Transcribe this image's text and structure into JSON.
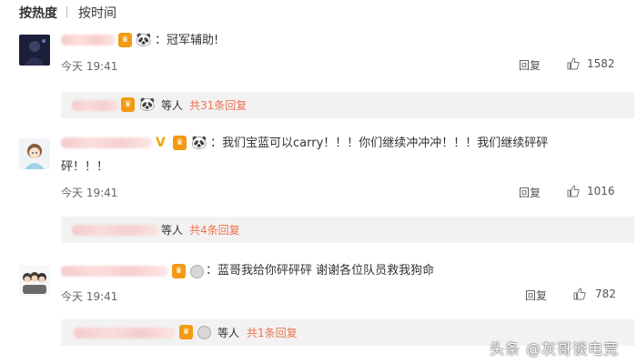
{
  "sort": {
    "hot": "按热度",
    "time": "按时间"
  },
  "comments": [
    {
      "text": "：冠军辅助!",
      "time": "今天 19:41",
      "reply": "回复",
      "likes": "1582",
      "sub": {
        "label": "等人",
        "count": "共31条回复"
      }
    },
    {
      "text_line1": "：我们宝蓝可以carry！！！你们继续冲冲冲！！！我们继续砰砰",
      "text_line2": "砰！！！",
      "time": "今天 19:41",
      "reply": "回复",
      "likes": "1016",
      "sub": {
        "label": "等人",
        "count": "共4条回复"
      }
    },
    {
      "text": "：蓝哥我给你砰砰砰 谢谢各位队员救我狗命",
      "time": "今天 19:41",
      "reply": "回复",
      "likes": "782",
      "sub": {
        "label": "等人",
        "count": "共1条回复"
      }
    }
  ],
  "icons": {
    "badge": "vip-badge-icon",
    "emoji": "panda-emoji-icon",
    "like": "thumbs-up-icon"
  },
  "colors": {
    "link_orange": "#eb7350",
    "badge_orange": "#f29a13",
    "sub_bg": "#f2f2f2"
  },
  "watermark": "头条 @灰哥谈电竞"
}
